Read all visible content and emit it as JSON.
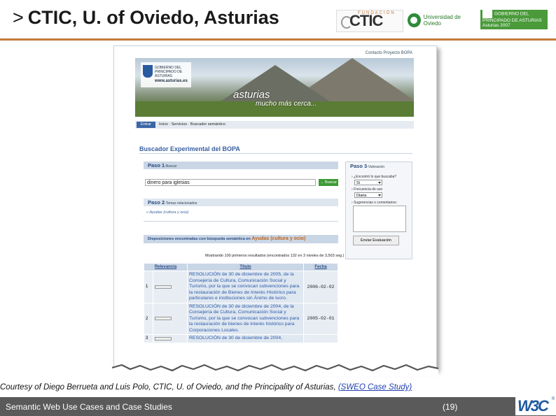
{
  "slide": {
    "title_chevron": ">",
    "title": "CTIC, U. of Oviedo, Asturias"
  },
  "logos": {
    "ctic_small": "FUNDACIÓN",
    "ctic_word": "CTIC",
    "university": "Universidad de Oviedo",
    "government": "GOBIERNO DEL PRINCIPADO DE ASTURIAS",
    "government_sub": "Asturias 2007"
  },
  "screenshot": {
    "contact_link": "Contacto Proyecto BOPA",
    "gov_logo_line1": "GOBIERNO DEL PRINCIPADO DE ASTURIAS",
    "gov_logo_url": "www.asturias.es",
    "slogan": "asturias",
    "slogan_sub": "mucho más cerca...",
    "nav_enter": "Entrar",
    "nav_path": "Inicio · Servicios · Buscador semántico",
    "search_title_prefix": "Buscador",
    "search_title": "Experimental del BOPA",
    "step1_title": "Paso 1",
    "step1_sub": "-Buscar",
    "query": "dinero para iglesias",
    "search_button": "→ Buscar",
    "step2_title": "Paso 2",
    "step2_sub": "-Temas relacionados",
    "step2_link": "» Ayudas (cultura y ocio)",
    "step3_title": "Paso 3",
    "step3_sub": "-Valoración",
    "step3_q1": "› ¿Encontró lo que buscaba?",
    "step3_q1_value": "Sí",
    "step3_q2": "› Frecuencia de uso",
    "step3_q2_value": "Diaria",
    "step3_q3": "› Sugerencias o comentarios:",
    "step3_send": "Enviar Evaluación",
    "result_bar_prefix": "Disposiciones encontradas con búsqueda semántica en",
    "result_bar_topic": "Ayudas (cultura y ocio)",
    "result_count": "Mostrando 100 primeros resultados (encontrados 132 en 3 niveles de 3,503 seg.)",
    "columns": [
      "Relevancia",
      "Título",
      "Fecha"
    ],
    "rows": [
      {
        "num": "1",
        "title": "RESOLUCIÓN de 30 de diciembre de 2005, de la Consejería de Cultura, Comunicación Social y Turismo, por la que se convocan subvenciones para la restauración de Bienes de Interés Histórico para particulares e instituciones sin Ánimo de lucro.",
        "date": "2006-02-02"
      },
      {
        "num": "2",
        "title": "RESOLUCIÓN de 30 de diciembre de 2004, de la Consejería de Cultura, Comunicación Social y Turismo, por la que se convocan subvenciones para la restauración de bienes de interés histórico para Corporaciones Locales.",
        "date": "2005-02-01"
      },
      {
        "num": "3",
        "title": "RESOLUCIÓN de 30 de diciembre de 2004,",
        "date": ""
      }
    ]
  },
  "caption": {
    "text": "Courtesy of Diego Berrueta and Luis Polo, CTIC, U. of Oviedo, and the Principality of Asturias,",
    "link": "(SWEO Case Study)"
  },
  "footer": {
    "text": "Semantic Web Use Cases and Case Studies",
    "page": "(19)",
    "w3c": "W3C",
    "w3c_reg": "®"
  },
  "colors": {
    "accent_rule": "#c4793a",
    "footer_bg": "#5a5a5a",
    "bopa_blue": "#3960a0",
    "search_green": "#3e9a35"
  }
}
